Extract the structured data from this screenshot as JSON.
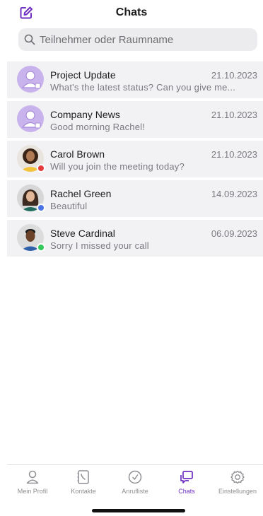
{
  "app": {
    "title": "Chats"
  },
  "colors": {
    "accent": "#6f2fc2",
    "avatar_group": "#c9b3ec",
    "status_red": "#e23b3b",
    "status_blue": "#4a74e6",
    "status_green": "#34c759"
  },
  "search": {
    "placeholder": "Teilnehmer oder Raumname",
    "value": ""
  },
  "chats": [
    {
      "name": "Project Update",
      "preview": "What's the latest status? Can you give me...",
      "date": "21.10.2023",
      "avatar": "group-avatar-icon"
    },
    {
      "name": "Company News",
      "preview": "Good morning Rachel!",
      "date": "21.10.2023",
      "avatar": "group-avatar-icon"
    },
    {
      "name": "Carol Brown",
      "preview": "Will you join the meeting today?",
      "date": "21.10.2023",
      "avatar": "photo",
      "status": "busy"
    },
    {
      "name": "Rachel Green",
      "preview": "Beautiful",
      "date": "14.09.2023",
      "avatar": "photo",
      "status": "away"
    },
    {
      "name": "Steve Cardinal",
      "preview": "Sorry I missed your call",
      "date": "06.09.2023",
      "avatar": "photo",
      "status": "online"
    }
  ],
  "tabs": [
    {
      "label": "Mein Profil",
      "icon": "person-icon"
    },
    {
      "label": "Kontakte",
      "icon": "contacts-icon"
    },
    {
      "label": "Anrufliste",
      "icon": "call-log-icon"
    },
    {
      "label": "Chats",
      "icon": "chat-icon",
      "active": true
    },
    {
      "label": "Einstellungen",
      "icon": "gear-icon"
    }
  ]
}
